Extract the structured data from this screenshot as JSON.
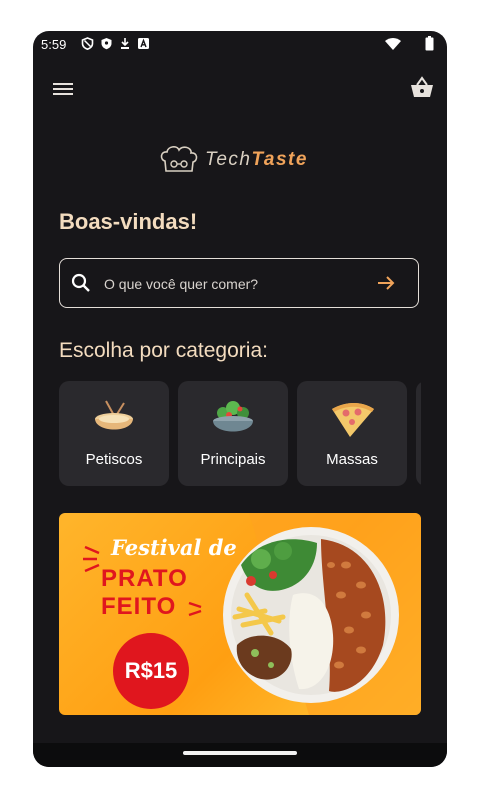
{
  "status": {
    "time": "5:59"
  },
  "header": {
    "menu_icon": "menu-icon",
    "cart_icon": "basket-icon"
  },
  "logo": {
    "part1": "Tech",
    "part2": "Taste"
  },
  "welcome": "Boas-vindas!",
  "search": {
    "placeholder": "O que você quer comer?"
  },
  "categories_title": "Escolha por categoria:",
  "categories": [
    {
      "label": "Petiscos"
    },
    {
      "label": "Principais"
    },
    {
      "label": "Massas"
    }
  ],
  "banner": {
    "line1": "Festival de",
    "line2": "PRATO",
    "line3": "FEITO",
    "price": "R$15"
  },
  "colors": {
    "background": "#171619",
    "accent": "#f0a35a",
    "heading": "#f3dcbf",
    "card": "#2a292d"
  }
}
